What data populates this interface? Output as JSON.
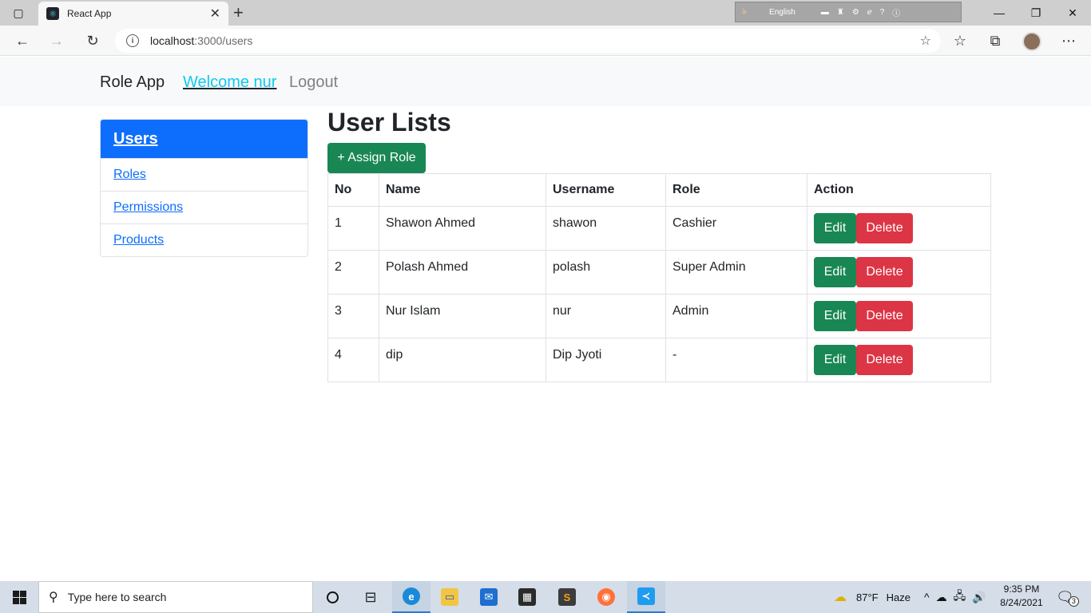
{
  "browser": {
    "tab_title": "React App",
    "url_host": "localhost",
    "url_path": ":3000/users",
    "ime_language": "English"
  },
  "navbar": {
    "brand": "Role App",
    "welcome": "Welcome nur",
    "logout": "Logout"
  },
  "sidebar": {
    "items": [
      {
        "label": "Users"
      },
      {
        "label": "Roles"
      },
      {
        "label": "Permissions"
      },
      {
        "label": "Products"
      }
    ]
  },
  "main": {
    "title": "User Lists",
    "assign_button": "+ Assign Role",
    "columns": [
      "No",
      "Name",
      "Username",
      "Role",
      "Action"
    ],
    "rows": [
      {
        "no": "1",
        "name": "Shawon Ahmed",
        "username": "shawon",
        "role": "Cashier"
      },
      {
        "no": "2",
        "name": "Polash Ahmed",
        "username": "polash",
        "role": "Super Admin"
      },
      {
        "no": "3",
        "name": "Nur Islam",
        "username": "nur",
        "role": "Admin"
      },
      {
        "no": "4",
        "name": "dip",
        "username": "Dip Jyoti",
        "role": "-"
      }
    ],
    "edit_label": "Edit",
    "delete_label": "Delete"
  },
  "taskbar": {
    "search_placeholder": "Type here to search",
    "weather": "87°F",
    "weather_desc": "Haze",
    "time": "9:35 PM",
    "date": "8/24/2021",
    "notification_count": "3"
  }
}
